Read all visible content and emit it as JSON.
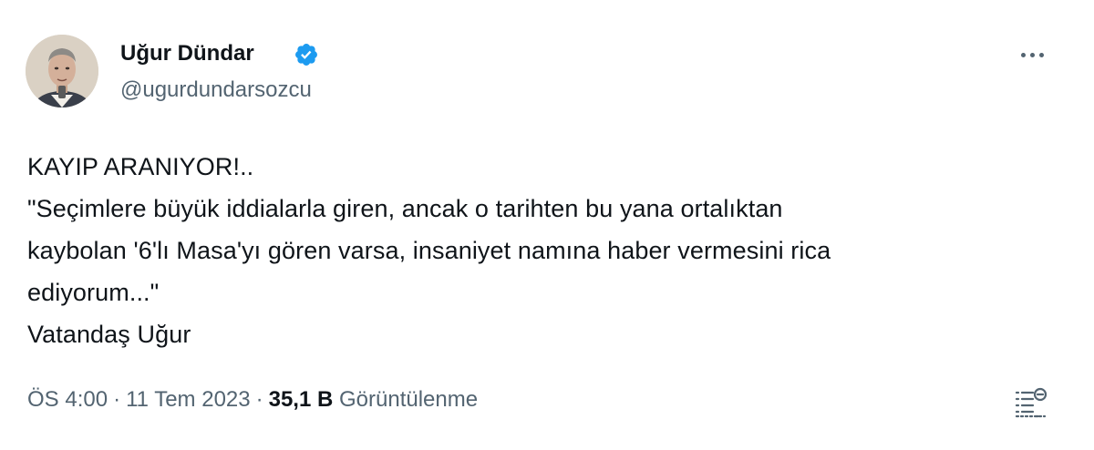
{
  "author": {
    "name": "Uğur Dündar",
    "handle": "@ugurdundarsozcu",
    "verified": true
  },
  "icons": {
    "verified": "verified-badge-icon",
    "more": "more-horizontal-icon",
    "views_detail": "list-detail-icon"
  },
  "tweet": {
    "lines": [
      "KAYIP ARANIYOR!..",
      "\"Seçimlere büyük iddialarla giren, ancak o tarihten bu yana ortalıktan",
      "kaybolan '6'lı Masa'yı gören varsa, insaniyet namına haber vermesini rica",
      "ediyorum...\"",
      "Vatandaş Uğur"
    ]
  },
  "meta": {
    "time": "ÖS 4:00",
    "separator": "·",
    "date": "11 Tem 2023",
    "views_count": "35,1 B",
    "views_label": "Görüntülenme"
  },
  "colors": {
    "text": "#0f1419",
    "secondary": "#536471",
    "verified_blue": "#1d9bf0"
  }
}
